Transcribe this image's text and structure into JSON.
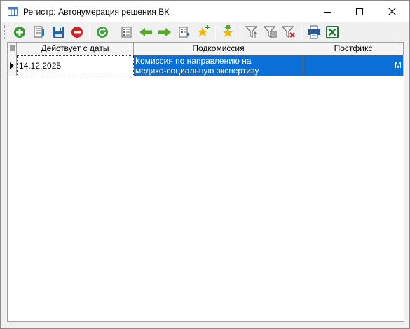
{
  "window": {
    "title": "Регистр: Автонумерация решения ВК"
  },
  "toolbar": {
    "buttons": [
      {
        "name": "add-icon",
        "color": "#2e9c2e"
      },
      {
        "name": "edit-document-icon",
        "color": "#3a6fb0"
      },
      {
        "name": "save-icon",
        "color": "#1f63b5"
      },
      {
        "name": "delete-icon",
        "color": "#d02020"
      },
      {
        "name": "refresh-icon",
        "color": "#3fa53f"
      },
      {
        "name": "view-record-icon",
        "color": "#6a6a6a"
      },
      {
        "name": "arrow-left-icon",
        "color": "#54a82a"
      },
      {
        "name": "arrow-right-icon",
        "color": "#54a82a"
      },
      {
        "name": "copy-record-icon",
        "color": "#6a6a6a"
      },
      {
        "name": "favorite-add-icon",
        "color": "#f2b400"
      },
      {
        "name": "favorite-down-icon",
        "color": "#f2b400"
      },
      {
        "name": "filter-icon",
        "color": "#707070"
      },
      {
        "name": "filter-edit-icon",
        "color": "#707070"
      },
      {
        "name": "filter-clear-icon",
        "color": "#d02020"
      },
      {
        "name": "print-icon",
        "color": "#2c5c96"
      },
      {
        "name": "excel-export-icon",
        "color": "#1e7b3a"
      }
    ]
  },
  "grid": {
    "columns": [
      "Действует с даты",
      "Подкомиссия",
      "Постфикс"
    ],
    "rows": [
      {
        "date": "14.12.2025",
        "subcommission_line1": "Комиссия по направлению на",
        "subcommission_line2": "медико-социальную экспертизу",
        "postfix": "М"
      }
    ]
  },
  "colors": {
    "selection": "#0a6fd6"
  }
}
